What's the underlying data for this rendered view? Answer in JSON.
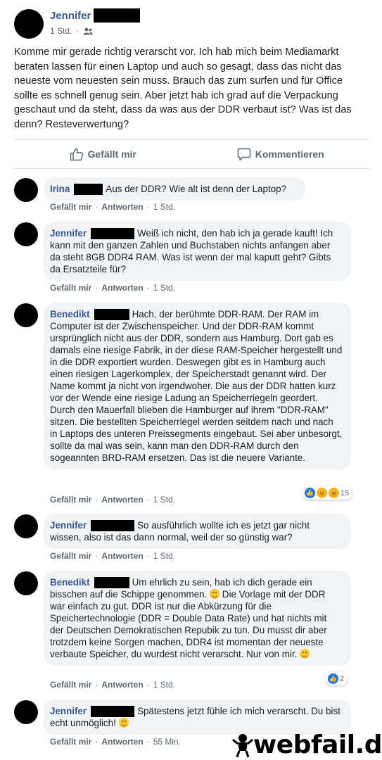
{
  "post": {
    "author": "Jennifer",
    "time": "1 Std.",
    "audience_icon": "friends-icon",
    "text": "Komme mir gerade richtig verarscht vor. Ich hab mich beim Mediamarkt beraten lassen für einen Laptop und auch so gesagt, dass das nicht das neueste vom neuesten sein muss. Brauch das zum surfen und für Office sollte es schnell genug sein. Aber jetzt hab ich grad auf die Verpackung geschaut und da steht, dass da was aus der DDR verbaut ist? Was ist das denn? Resteverwertung?"
  },
  "actions": {
    "like_label": "Gefällt mir",
    "comment_label": "Kommentieren"
  },
  "comment_links": {
    "like": "Gefällt mir",
    "reply": "Antworten"
  },
  "comments": [
    {
      "author": "Irina",
      "text": "Aus der DDR? Wie alt ist denn der Laptop?",
      "time": "1 Std."
    },
    {
      "author": "Jennifer",
      "text": "Weiß ich nicht, den hab ich ja gerade kauft! Ich kann mit den ganzen Zahlen und Buchstaben nichts anfangen aber da steht 8GB DDR4 RAM. Was ist wenn der mal kaputt geht? Gibts da Ersatzteile für?",
      "time": "1 Std."
    },
    {
      "author": "Benedikt",
      "text": "Hach, der berühmte DDR-RAM. Der RAM im Computer ist der Zwischenspeicher. Und der DDR-RAM kommt ursprünglich nicht aus der DDR, sondern aus Hamburg. Dort gab es damals eine riesige Fabrik, in der diese RAM-Speicher hergestellt und in die DDR exportiert wurden. Deswegen gibt es in Hamburg auch einen riesigen Lagerkomplex, der Speicherstadt genannt wird. Der Name kommt ja nicht von irgendwoher. Die aus der DDR hatten kurz vor der Wende eine riesige Ladung an Speicherriegeln geordert. Durch den Mauerfall blieben die Hamburger auf ihrem \"DDR-RAM\" sitzen. Die bestellten Speicherriegel werden seitdem nach und nach in Laptops des unteren Preissegments eingebaut. Sei aber unbesorgt, sollte da mal was sein, kann man den DDR-RAM durch den sogeannten BRD-RAM ersetzen. Das ist die neuere Variante.",
      "time": "1 Std.",
      "reactions": "15"
    },
    {
      "author": "Jennifer",
      "text": "So ausführlich wollte ich es jetzt gar nicht wissen, also ist das dann normal, weil der so günstig war?",
      "time": "1 Std."
    },
    {
      "author": "Benedikt",
      "text_a": "Um ehrlich zu sein, hab ich dich gerade ein bisschen auf die Schippe genommen.",
      "text_b": "Die Vorlage mit der DDR war einfach zu gut. DDR ist nur die Abkürzung für die Speichertechnologie (DDR = Double Data Rate) und hat nichts mit der Deutschen Demokratischen Repubik zu tun. Du musst dir aber trotzdem keine Sorgen machen, DDR4 ist momentan der neueste verbaute Speicher, du wurdest nicht verarscht. Nur von mir.",
      "time": "1 Std.",
      "reactions": "2"
    },
    {
      "author": "Jennifer",
      "text": "Spätestens jetzt fühle ich mich verarscht. Du bist echt unmöglich!",
      "time": "55 Min."
    }
  ],
  "watermark": "webfail.de"
}
